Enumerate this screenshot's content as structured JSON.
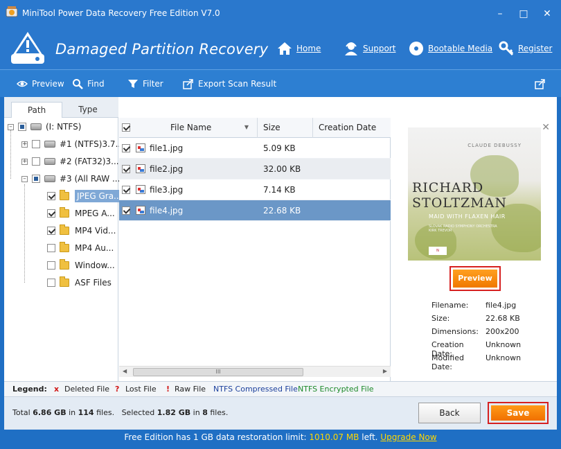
{
  "window": {
    "title": "MiniTool Power Data Recovery Free Edition V7.0",
    "minimize": "–",
    "restore": "□",
    "close": "✕"
  },
  "header": {
    "heading": "Damaged Partition Recovery",
    "links": {
      "home": "Home",
      "support": "Support",
      "bootable": "Bootable Media",
      "register": "Register"
    }
  },
  "toolbar": {
    "preview": "Preview",
    "find": "Find",
    "filter": "Filter",
    "export": "Export Scan Result"
  },
  "tabs": {
    "path": "Path",
    "type": "Type"
  },
  "tree": {
    "root": "(I: NTFS)",
    "p1": "#1 (NTFS)3.7...",
    "p2": "#2 (FAT32)3....",
    "p3": "#3 (All RAW ...",
    "f1": "JPEG Gra...",
    "f2": "MPEG A...",
    "f3": "MP4 Vid...",
    "f4": "MP4 Au...",
    "f5": "Window...",
    "f6": "ASF Files"
  },
  "filelist": {
    "columns": {
      "name": "File Name",
      "size": "Size",
      "created": "Creation Date"
    },
    "rows": [
      {
        "name": "file1.jpg",
        "size": "5.09 KB"
      },
      {
        "name": "file2.jpg",
        "size": "32.00 KB"
      },
      {
        "name": "file3.jpg",
        "size": "7.14 KB"
      },
      {
        "name": "file4.jpg",
        "size": "22.68 KB"
      }
    ],
    "scroll_grip": "III"
  },
  "preview": {
    "album": {
      "composer": "CLAUDE DEBUSSY",
      "artist_line1": "RICHARD",
      "artist_line2": "STOLTZMAN",
      "work": "MAID WITH FLAXEN HAIR",
      "orchestra1": "SLOVAK RADIO SYMPHONY ORCHESTRA",
      "orchestra2": "KIRK TREVOR"
    },
    "button": "Preview",
    "info": {
      "filename_label": "Filename:",
      "filename": "file4.jpg",
      "size_label": "Size:",
      "size": "22.68 KB",
      "dimensions_label": "Dimensions:",
      "dimensions": "200x200",
      "creation_label": "Creation Date:",
      "creation": "Unknown",
      "modified_label": "Modified Date:",
      "modified": "Unknown"
    }
  },
  "legend": {
    "title": "Legend:",
    "deleted_mark": "x",
    "deleted": "Deleted File",
    "lost_mark": "?",
    "lost": "Lost File",
    "raw_mark": "!",
    "raw": "Raw File",
    "compressed": "NTFS Compressed File",
    "encrypted": "NTFS Encrypted File"
  },
  "summary": {
    "total_prefix": "Total",
    "total_size": "6.86 GB",
    "in1": "in",
    "total_files": "114",
    "files1": "files.",
    "selected_prefix": "Selected",
    "selected_size": "1.82 GB",
    "in2": "in",
    "selected_files": "8",
    "files2": "files."
  },
  "actions": {
    "back": "Back",
    "save": "Save"
  },
  "footer": {
    "prefix": "Free Edition has 1 GB data restoration limit:",
    "remaining": "1010.07 MB",
    "suffix": "left.",
    "upgrade": "Upgrade Now"
  },
  "colors": {
    "titlebar": "#2a78cd",
    "toolbar": "#2d7fd2",
    "accent_orange": "#f07800",
    "highlight_red": "#d62020",
    "selected_row": "#6b97c7",
    "compressed_text": "#1b3f9c",
    "encrypted_text": "#1e8a2a"
  }
}
